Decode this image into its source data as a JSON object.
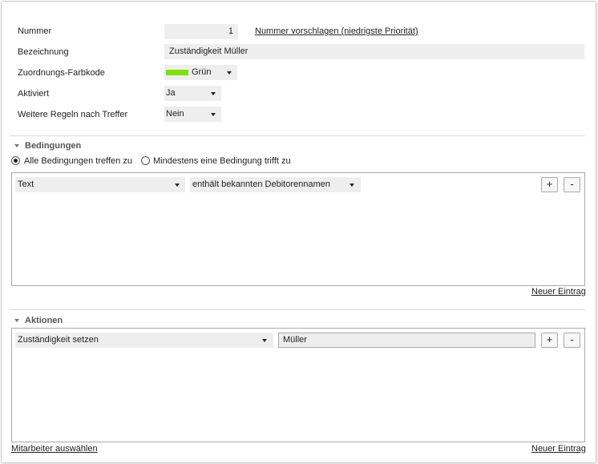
{
  "form": {
    "number_label": "Nummer",
    "number_value": "1",
    "suggest_number_link": "Nummer vorschlagen (niedrigste Priorität)",
    "name_label": "Bezeichnung",
    "name_value": "Zuständigkeit Müller",
    "color_label": "Zuordnungs-Farbkode",
    "color_value": "Grün",
    "color_swatch": "#7ae500",
    "activated_label": "Aktiviert",
    "activated_value": "Ja",
    "more_rules_label": "Weitere Regeln nach Treffer",
    "more_rules_value": "Nein"
  },
  "conditions": {
    "title": "Bedingungen",
    "radio_all": "Alle Bedingungen treffen zu",
    "radio_any": "Mindestens eine Bedingung trifft zu",
    "selected": "all",
    "rows": [
      {
        "field": "Text",
        "operator": "enthält bekannten Debitorennamen"
      }
    ],
    "new_entry_link": "Neuer Eintrag"
  },
  "actions": {
    "title": "Aktionen",
    "rows": [
      {
        "action": "Zuständigkeit setzen",
        "value": "Müller"
      }
    ],
    "select_employee_link": "Mitarbeiter auswählen",
    "new_entry_link": "Neuer Eintrag"
  },
  "buttons": {
    "add": "+",
    "remove": "-"
  }
}
